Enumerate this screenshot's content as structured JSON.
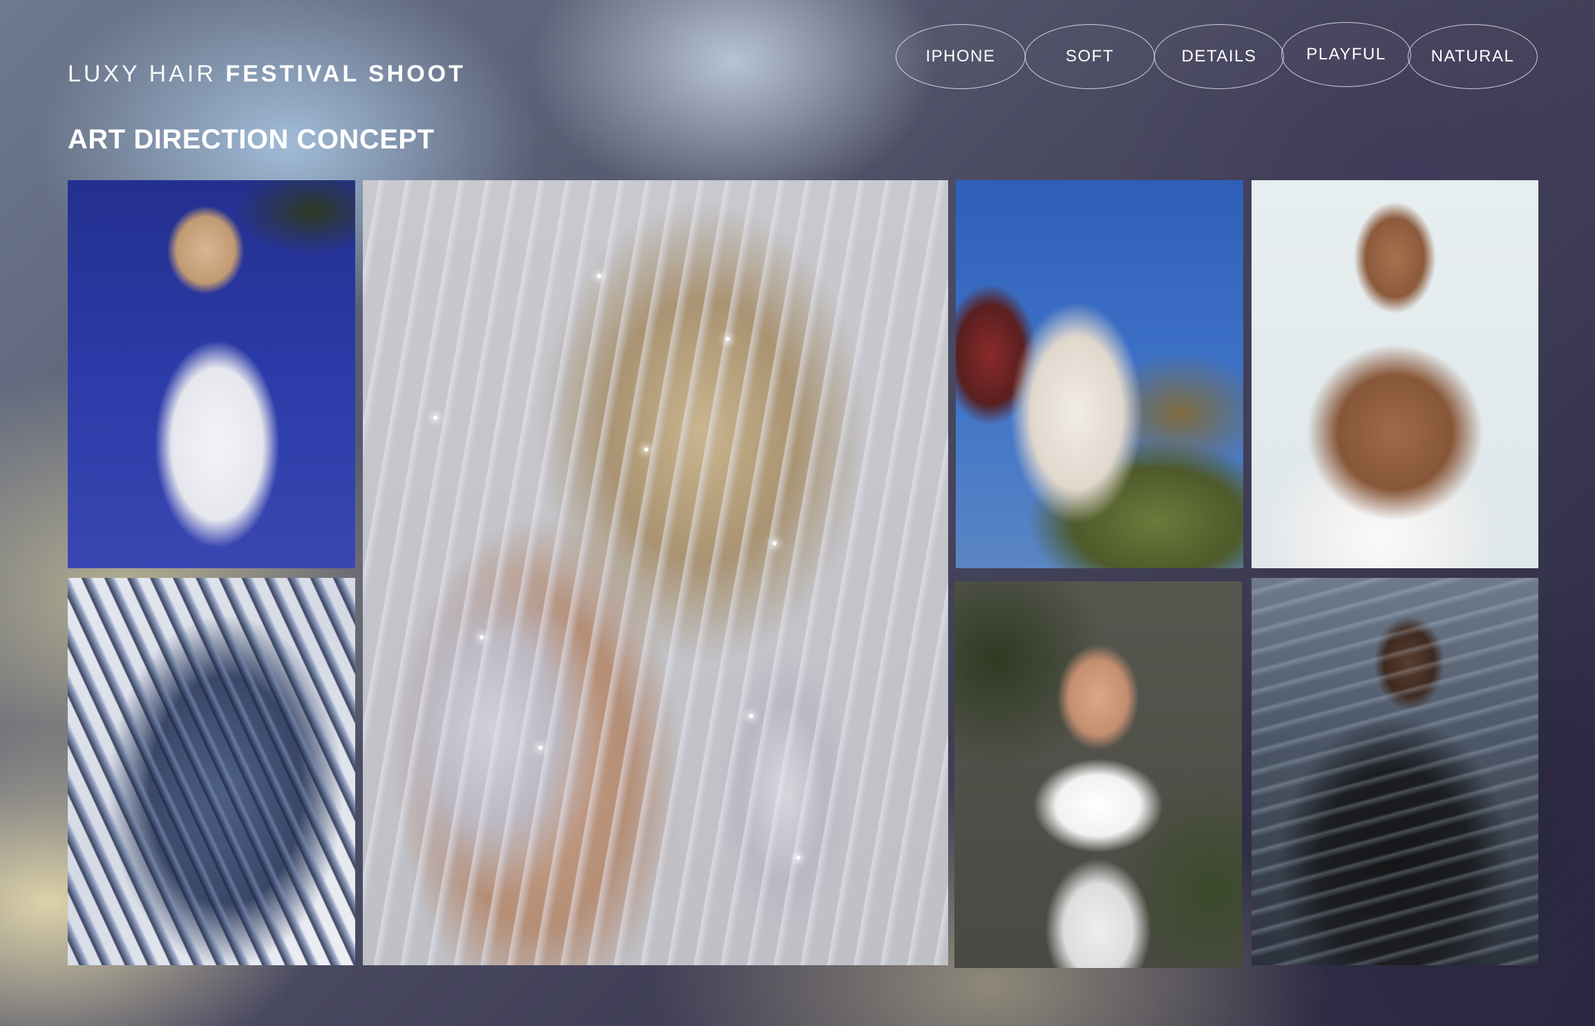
{
  "header": {
    "brand_light": "LUXY HAIR",
    "brand_bold": "FESTIVAL SHOOT",
    "subtitle": "ART DIRECTION CONCEPT"
  },
  "tags": [
    {
      "label": "IPHONE"
    },
    {
      "label": "SOFT"
    },
    {
      "label": "DETAILS"
    },
    {
      "label": "PLAYFUL"
    },
    {
      "label": "NATURAL"
    }
  ]
}
